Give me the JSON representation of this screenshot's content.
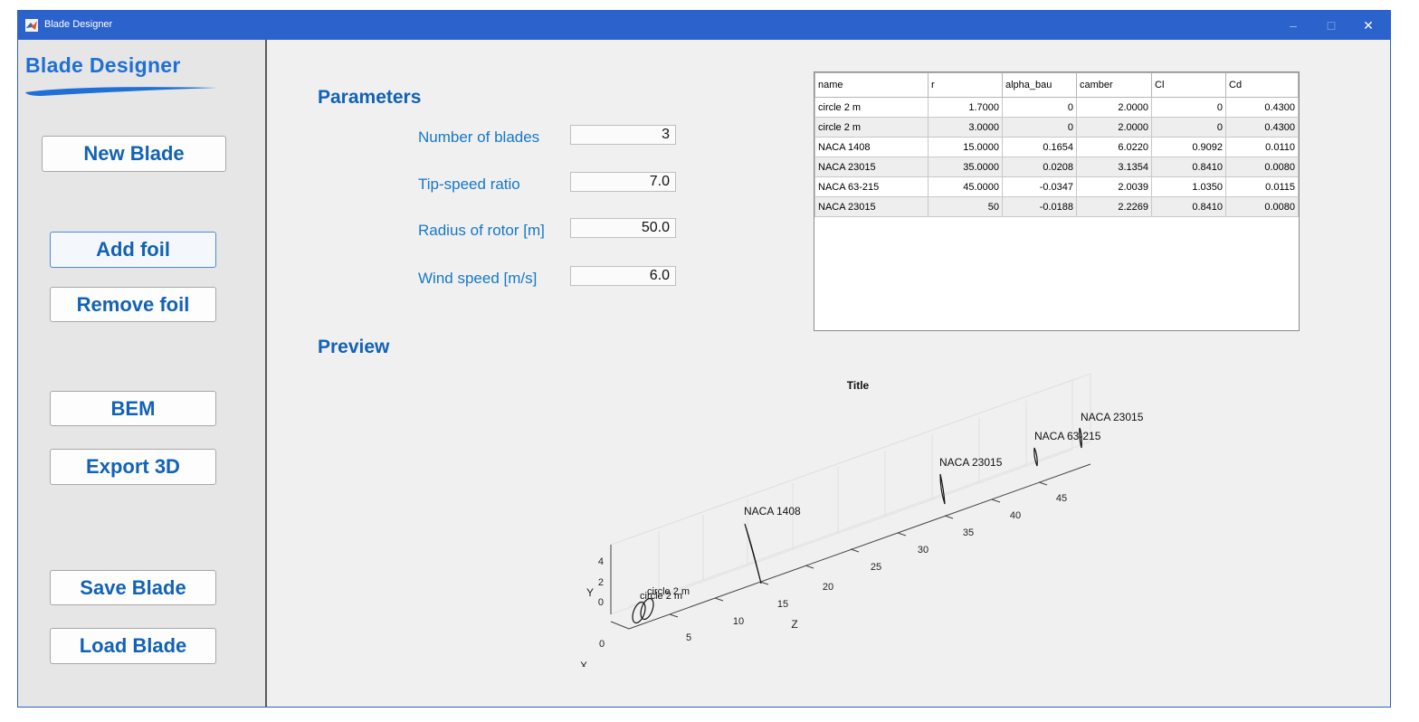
{
  "window": {
    "title": "Blade Designer",
    "controls": {
      "minimize": "–",
      "maximize": "□",
      "close": "✕"
    }
  },
  "sidebar": {
    "logo": "Blade Designer",
    "buttons": {
      "new_blade": "New Blade",
      "add_foil": "Add foil",
      "remove_foil": "Remove foil",
      "bem": "BEM",
      "export_3d": "Export 3D",
      "save_blade": "Save Blade",
      "load_blade": "Load Blade"
    }
  },
  "parameters": {
    "heading": "Parameters",
    "number_of_blades": {
      "label": "Number of blades",
      "value": "3"
    },
    "tip_speed_ratio": {
      "label": "Tip-speed ratio",
      "value": "7.0"
    },
    "radius_of_rotor": {
      "label": "Radius of rotor [m]",
      "value": "50.0"
    },
    "wind_speed": {
      "label": "Wind speed [m/s]",
      "value": "6.0"
    }
  },
  "foil_table": {
    "columns": [
      "name",
      "r",
      "alpha_bau",
      "camber",
      "Cl",
      "Cd"
    ],
    "rows": [
      [
        "circle 2 m",
        "1.7000",
        "0",
        "2.0000",
        "0",
        "0.4300"
      ],
      [
        "circle 2 m",
        "3.0000",
        "0",
        "2.0000",
        "0",
        "0.4300"
      ],
      [
        "NACA 1408",
        "15.0000",
        "0.1654",
        "6.0220",
        "0.9092",
        "0.0110"
      ],
      [
        "NACA 23015",
        "35.0000",
        "0.0208",
        "3.1354",
        "0.8410",
        "0.0080"
      ],
      [
        "NACA 63-215",
        "45.0000",
        "-0.0347",
        "2.0039",
        "1.0350",
        "0.0115"
      ],
      [
        "NACA 23015",
        "50",
        "-0.0188",
        "2.2269",
        "0.8410",
        "0.0080"
      ]
    ]
  },
  "preview": {
    "heading": "Preview",
    "plot": {
      "title": "Title",
      "xlabel": "X",
      "ylabel": "Y",
      "zlabel": "Z",
      "y_ticks": [
        "4",
        "2",
        "0"
      ],
      "x_tick": "0",
      "z_ticks": [
        "5",
        "10",
        "15",
        "20",
        "25",
        "30",
        "35",
        "40",
        "45"
      ],
      "foil_labels": [
        {
          "text": "circle 2 m",
          "z": 1.7
        },
        {
          "text": "circle 2 m",
          "z": 3.0
        },
        {
          "text": "NACA 1408",
          "z": 15
        },
        {
          "text": "NACA 23015",
          "z": 35
        },
        {
          "text": "NACA 63-215",
          "z": 45
        },
        {
          "text": "NACA 23015",
          "z": 50
        }
      ]
    }
  },
  "colors": {
    "titlebar": "#2b62cc",
    "accent_text": "#1262b6",
    "label_text": "#1678c8",
    "logo": "#1f6fd6"
  }
}
